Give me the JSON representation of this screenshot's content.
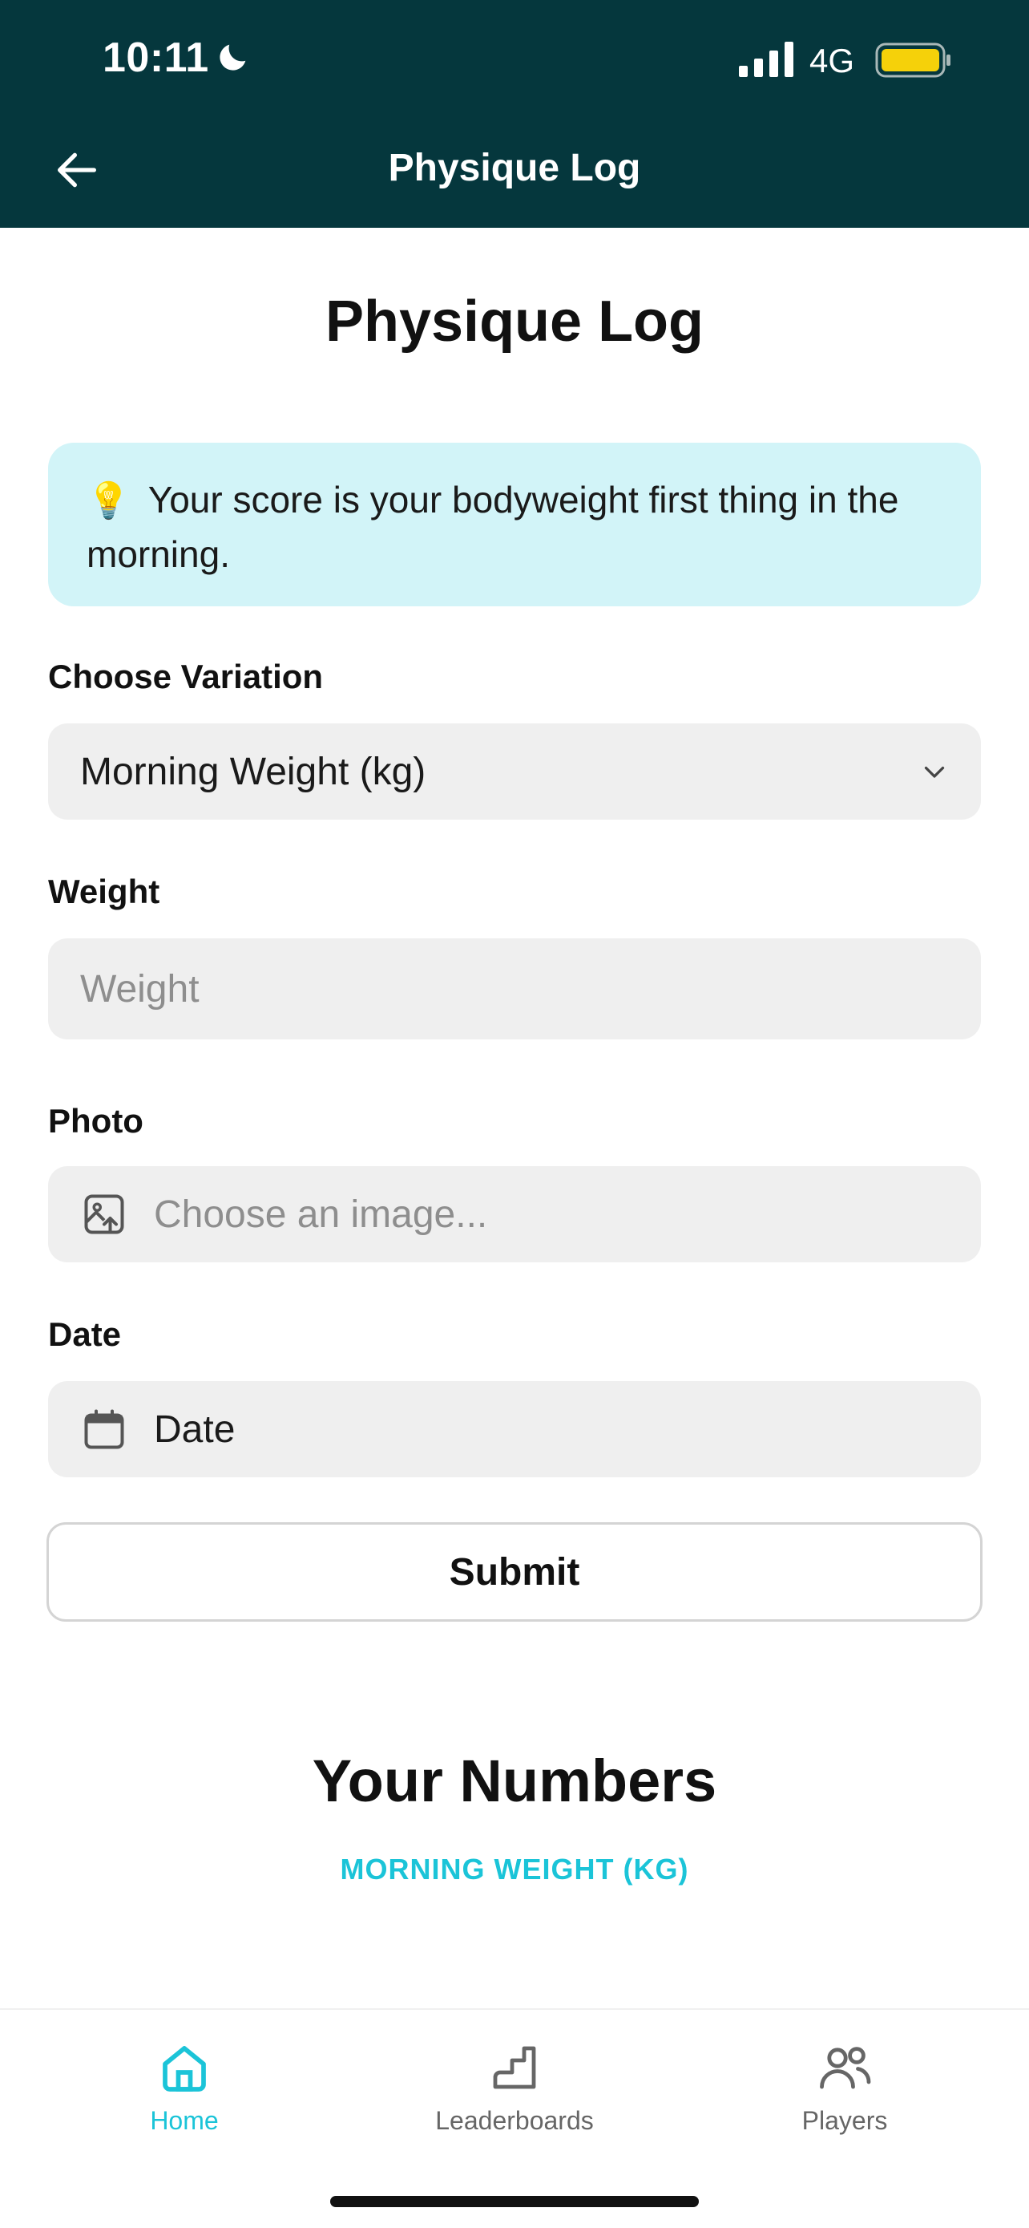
{
  "status_bar": {
    "time": "10:11",
    "network": "4G",
    "icons": [
      "moon-icon",
      "signal-icon",
      "battery-icon"
    ],
    "battery_color": "#f5d10a"
  },
  "header": {
    "title": "Physique Log",
    "back_icon": "arrow-left-icon",
    "background_color": "#05373d"
  },
  "main": {
    "title": "Physique Log",
    "tip": {
      "icon": "💡",
      "text": "Your score is your bodyweight first thing in the morning.",
      "background_color": "#d2f4f8"
    },
    "variation": {
      "label": "Choose Variation",
      "selected": "Morning Weight (kg)"
    },
    "weight": {
      "label": "Weight",
      "placeholder": "Weight"
    },
    "photo": {
      "label": "Photo",
      "placeholder": "Choose an image..."
    },
    "date": {
      "label": "Date",
      "value": "Date"
    },
    "submit_label": "Submit",
    "numbers": {
      "title": "Your Numbers",
      "variation": "MORNING WEIGHT (KG)",
      "accent_color": "#1bc4d8"
    }
  },
  "tabbar": {
    "items": [
      {
        "label": "Home",
        "icon": "home-icon",
        "active": true
      },
      {
        "label": "Leaderboards",
        "icon": "stairs-icon",
        "active": false
      },
      {
        "label": "Players",
        "icon": "users-icon",
        "active": false
      }
    ]
  }
}
